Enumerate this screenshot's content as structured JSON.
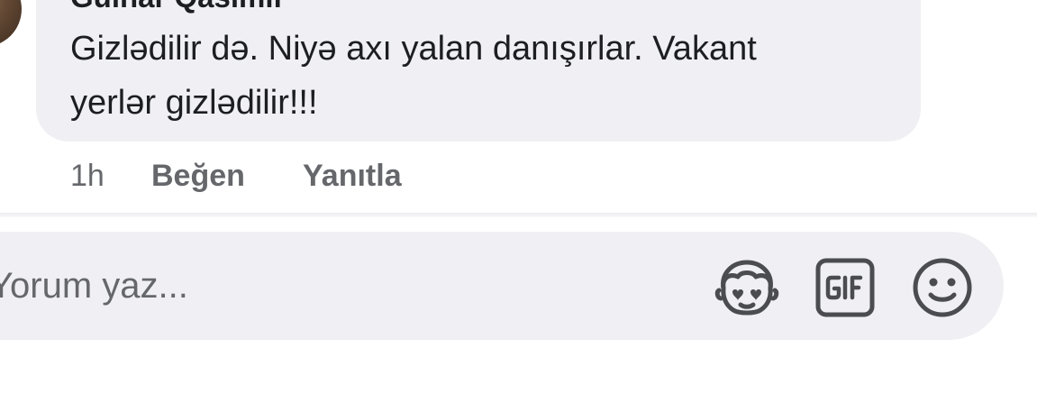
{
  "comment": {
    "author": "Gülnar Qasımlı",
    "text_line1": "Gizlədilir də. Niyə axı yalan danışırlar. Vakant",
    "text_line2": "yerlər gizlədilir!!!",
    "time": "1h",
    "like_label": "Beğen",
    "reply_label": "Yanıtla"
  },
  "composer": {
    "placeholder": "Yorum yaz...",
    "icons": [
      "avatar-sticker-icon",
      "gif-icon",
      "emoji-icon"
    ]
  },
  "colors": {
    "bubble_bg": "#f0f0f4",
    "text": "#1c1e21",
    "secondary_text": "#65676b",
    "icon": "#4b4c4f"
  }
}
